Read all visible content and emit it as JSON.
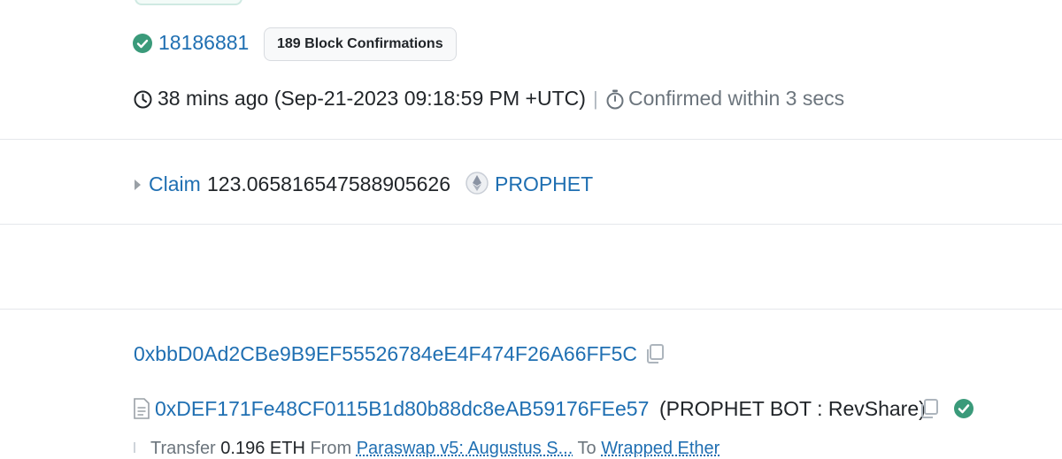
{
  "block": {
    "number": "18186881",
    "confirmations_label": "189 Block Confirmations"
  },
  "timestamp": {
    "relative_and_absolute": "38 mins ago (Sep-21-2023 09:18:59 PM +UTC)",
    "separator": "|",
    "confirmed_within": "Confirmed within 3 secs"
  },
  "action": {
    "label": "Claim",
    "amount": "123.065816547588905626",
    "token": "PROPHET"
  },
  "from": {
    "address": "0xbbD0Ad2CBe9B9EF55526784eE4F474F26A66FF5C"
  },
  "to": {
    "address": "0xDEF171Fe48CF0115B1d80b88dc8eAB59176FEe57",
    "name": "(PROPHET BOT : RevShare)"
  },
  "transfer": {
    "label": "Transfer",
    "amount": "0.196 ETH",
    "from_label": "From",
    "from_name": "Paraswap v5: Augustus S...",
    "to_label": "To",
    "to_name": "Wrapped Ether"
  },
  "colors": {
    "link": "#1f6fb2",
    "success": "#3a9a7a",
    "muted": "#6c757d"
  },
  "icons": [
    "check-circle-icon",
    "clock-icon",
    "timer-icon",
    "caret-right-icon",
    "ethereum-token-icon",
    "copy-icon",
    "contract-file-icon",
    "verified-check-icon"
  ]
}
